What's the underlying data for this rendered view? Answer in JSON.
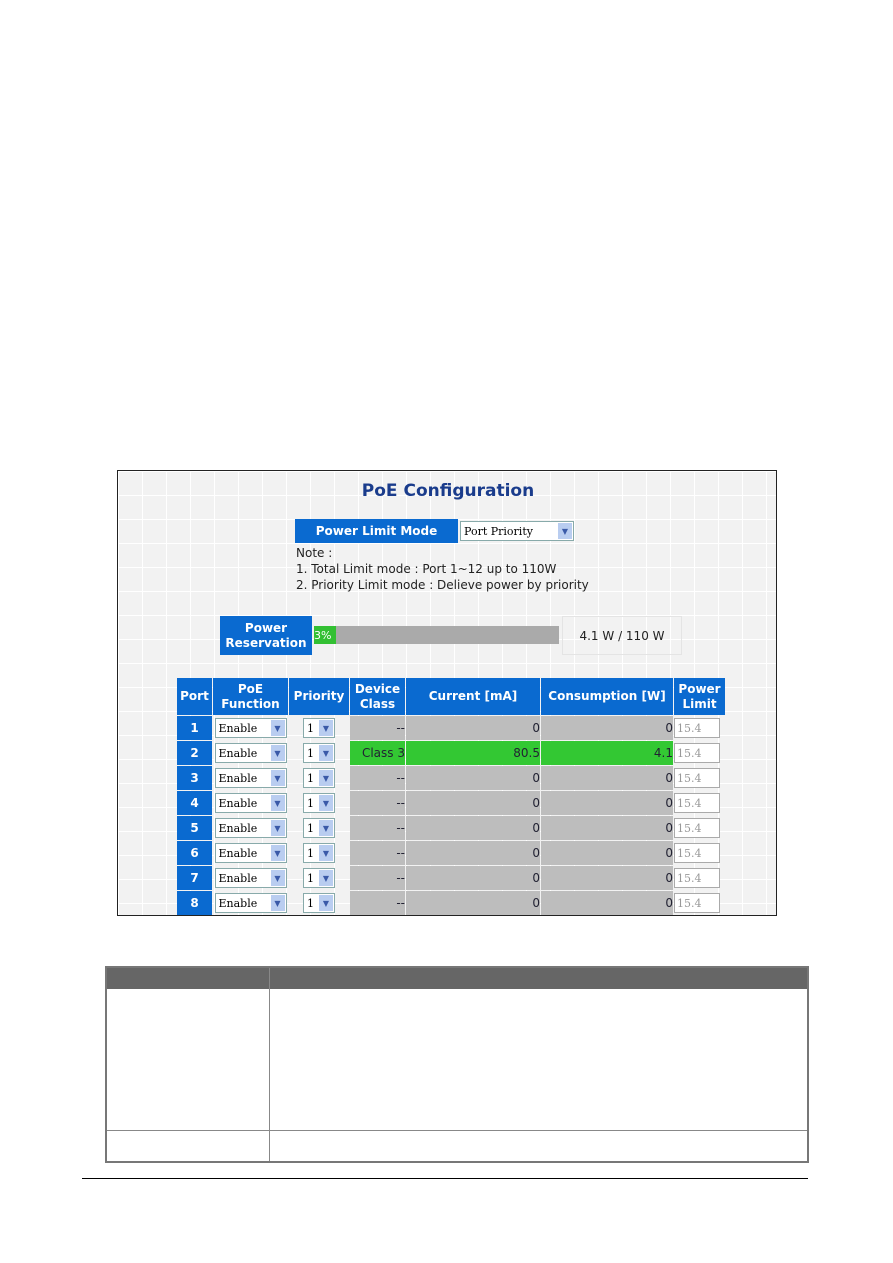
{
  "page_title": "PoE Configuration",
  "power_limit_mode": {
    "label": "Power Limit Mode",
    "value": "Port Priority"
  },
  "note": {
    "heading": "Note :",
    "lines": [
      "1. Total Limit mode : Port 1~12 up to 110W",
      "2. Priority Limit mode : Delieve power by priority"
    ]
  },
  "power_reservation": {
    "label": "Power Reservation",
    "percent_label": "3%",
    "percent": 3,
    "value": "4.1 W / 110 W"
  },
  "colors": {
    "header_blue": "#0a6ad0",
    "active_green": "#33c833",
    "inactive_gray": "#bdbdbd"
  },
  "table": {
    "headers": [
      "Port",
      "PoE Function",
      "Priority",
      "Device Class",
      "Current [mA]",
      "Consumption [W]",
      "Power Limit"
    ],
    "rows": [
      {
        "port": "1",
        "function": "Enable",
        "priority": "1",
        "class": "--",
        "current": "0",
        "consumption": "0",
        "limit": "15.4",
        "active": false
      },
      {
        "port": "2",
        "function": "Enable",
        "priority": "1",
        "class": "Class 3",
        "current": "80.5",
        "consumption": "4.1",
        "limit": "15.4",
        "active": true
      },
      {
        "port": "3",
        "function": "Enable",
        "priority": "1",
        "class": "--",
        "current": "0",
        "consumption": "0",
        "limit": "15.4",
        "active": false
      },
      {
        "port": "4",
        "function": "Enable",
        "priority": "1",
        "class": "--",
        "current": "0",
        "consumption": "0",
        "limit": "15.4",
        "active": false
      },
      {
        "port": "5",
        "function": "Enable",
        "priority": "1",
        "class": "--",
        "current": "0",
        "consumption": "0",
        "limit": "15.4",
        "active": false
      },
      {
        "port": "6",
        "function": "Enable",
        "priority": "1",
        "class": "--",
        "current": "0",
        "consumption": "0",
        "limit": "15.4",
        "active": false
      },
      {
        "port": "7",
        "function": "Enable",
        "priority": "1",
        "class": "--",
        "current": "0",
        "consumption": "0",
        "limit": "15.4",
        "active": false
      },
      {
        "port": "8",
        "function": "Enable",
        "priority": "1",
        "class": "--",
        "current": "0",
        "consumption": "0",
        "limit": "15.4",
        "active": false
      }
    ]
  }
}
